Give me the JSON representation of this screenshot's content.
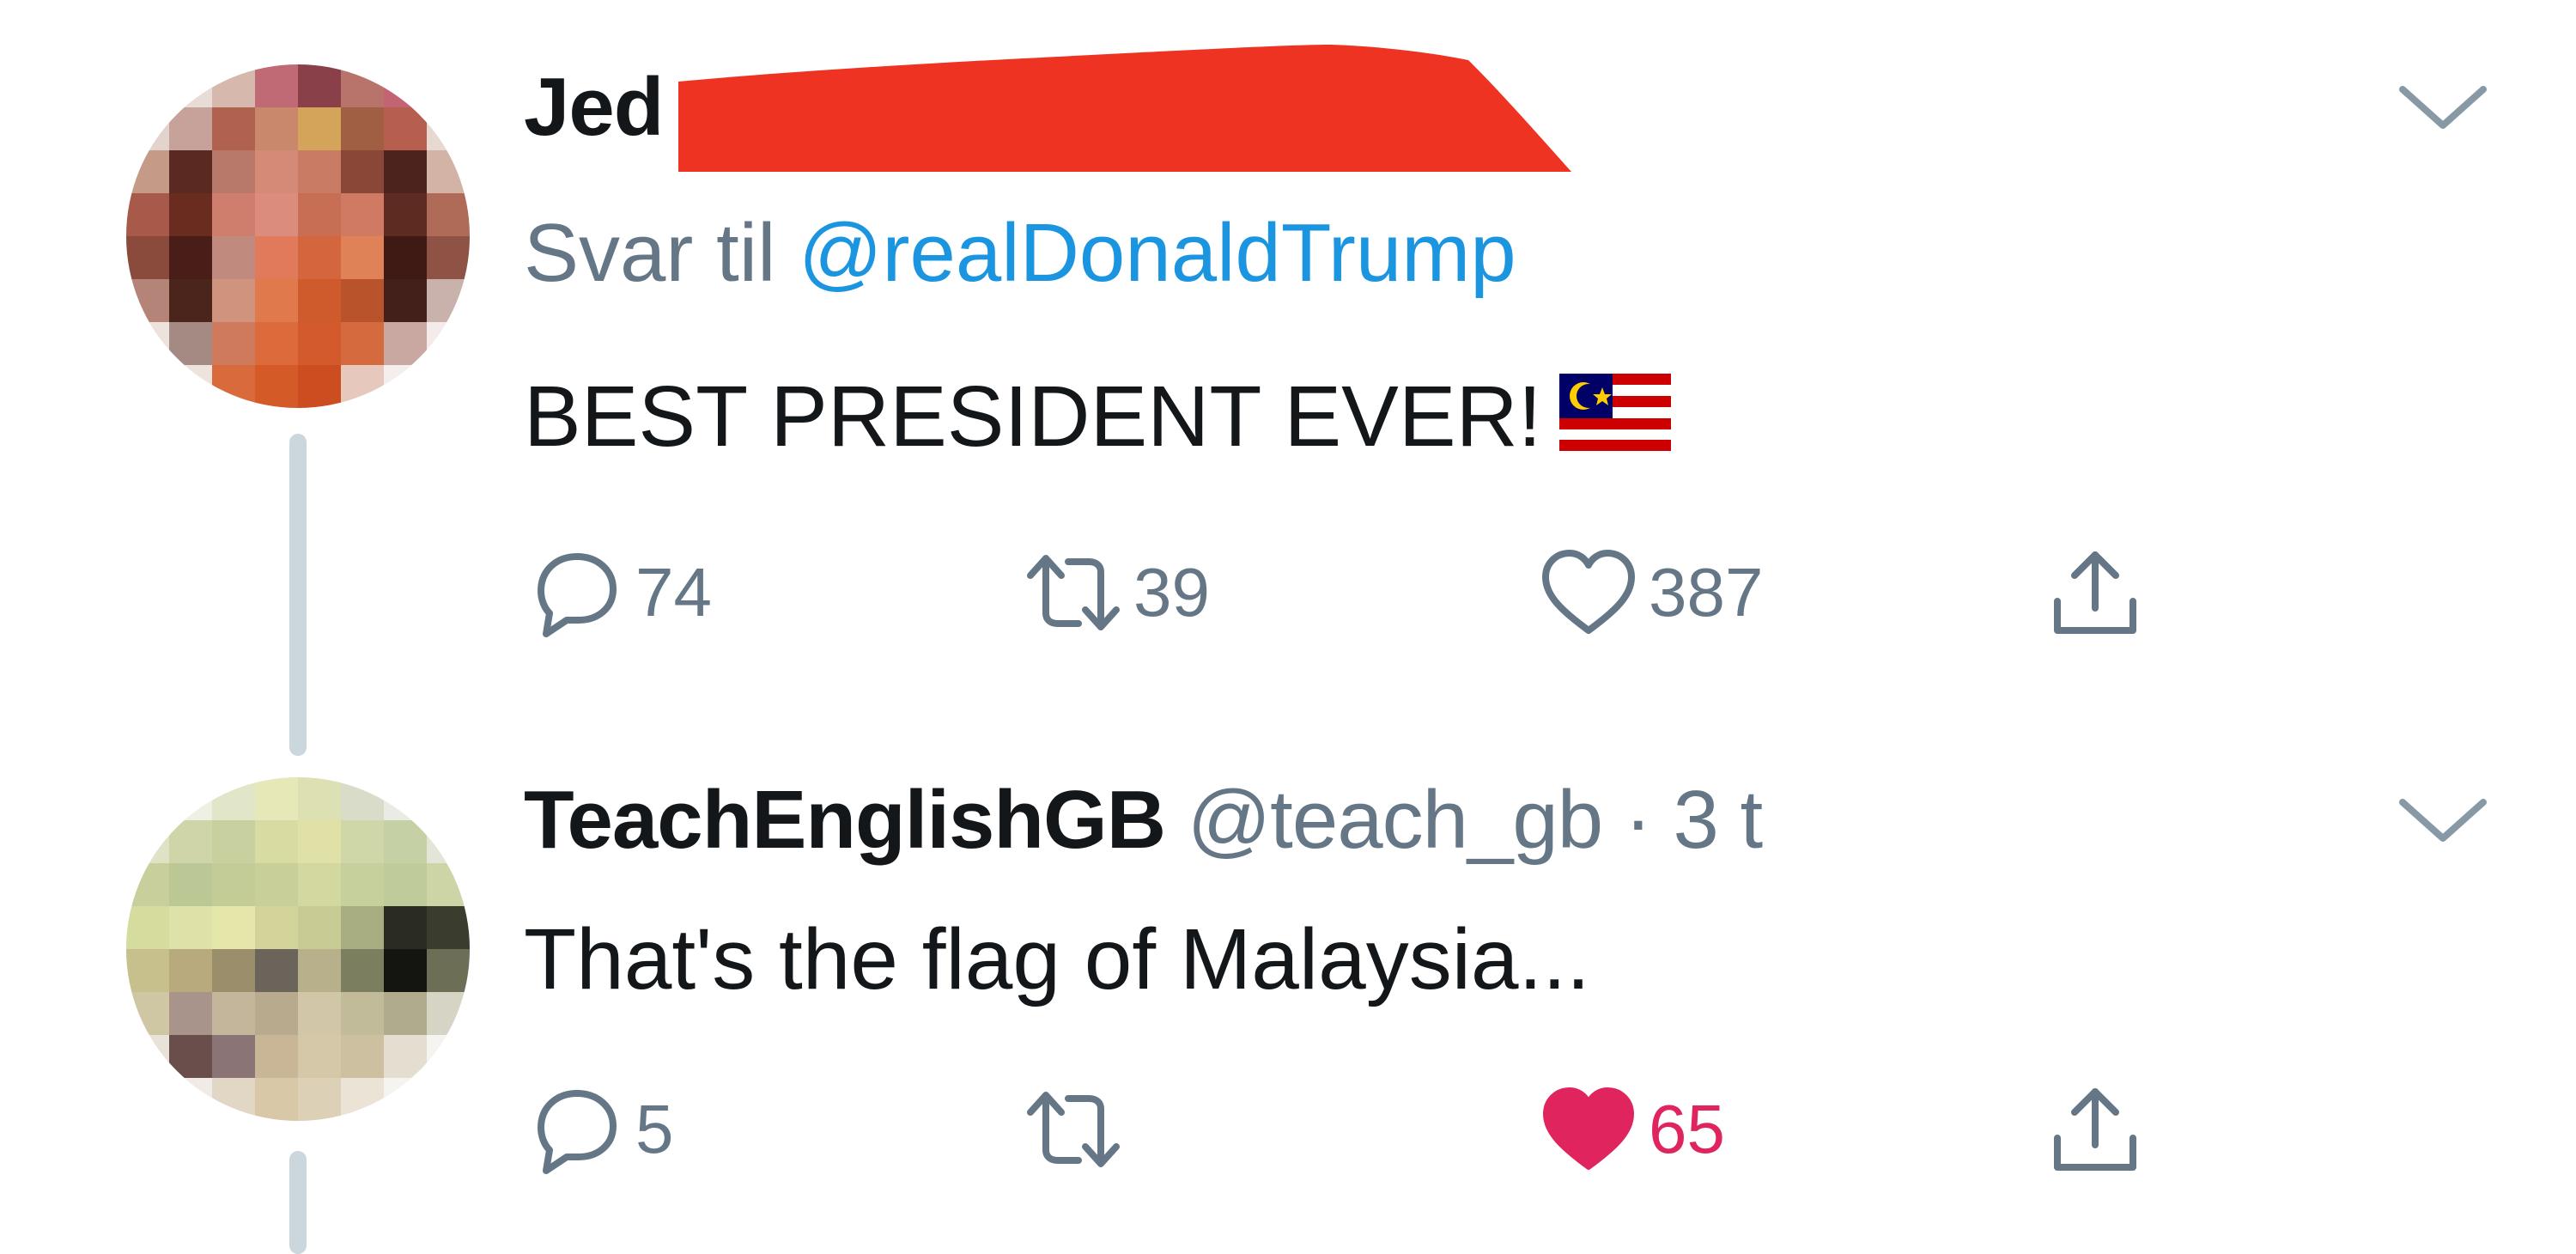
{
  "tweets": [
    {
      "name": "Jed",
      "reply_prefix": "Svar til",
      "reply_mention": "@realDonaldTrump",
      "text": "BEST PRESIDENT EVER!",
      "emoji_icon": "malaysia-flag-icon",
      "actions": {
        "replies": "74",
        "retweets": "39",
        "likes": "387"
      },
      "liked": false
    },
    {
      "name": "TeachEnglishGB",
      "handle": "@teach_gb",
      "separator": "·",
      "time": "3 t",
      "text": "That's the flag of Malaysia...",
      "actions": {
        "replies": "5",
        "likes": "65"
      },
      "liked": true
    }
  ],
  "colors": {
    "text": "#14171a",
    "muted": "#657786",
    "link": "#1b95e0",
    "like": "#e0245e",
    "redaction": "#ee3322"
  },
  "icons": [
    "chevron-down-icon",
    "reply-icon",
    "retweet-icon",
    "heart-icon",
    "share-icon"
  ]
}
